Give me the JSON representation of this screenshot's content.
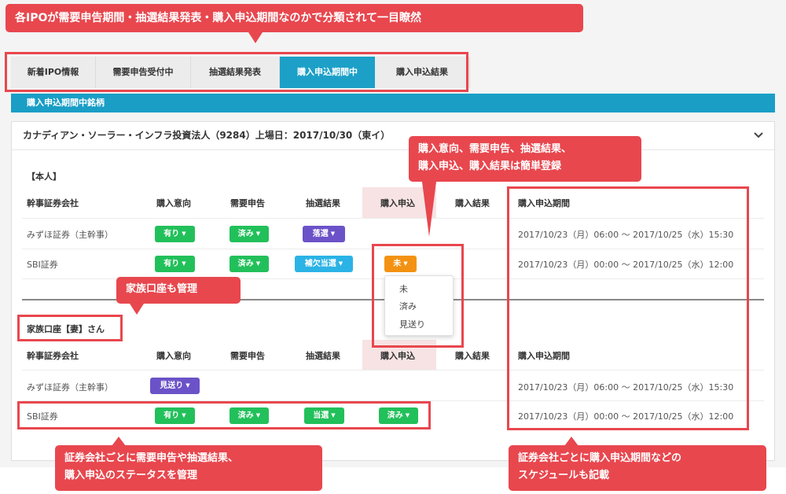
{
  "callouts": {
    "top": "各IPOが需要申告期間・抽選結果発表・購入申込期間なのかで分類されて一目瞭然",
    "register_line1": "購入意向、需要申告、抽選結果、",
    "register_line2": "購入申込、購入結果は簡単登録",
    "family": "家族口座も管理",
    "status_line1": "証券会社ごとに需要申告や抽選結果、",
    "status_line2": "購入申込のステータスを管理",
    "schedule_line1": "証券会社ごとに購入申込期間などの",
    "schedule_line2": "スケジュールも記載"
  },
  "tabs": [
    "新着IPO情報",
    "需要申告受付中",
    "抽選結果発表",
    "購入申込期間中",
    "購入申込結果"
  ],
  "active_tab": "購入申込期間中",
  "section_title": "購入申込期間中銘柄",
  "panel": {
    "title": "カナディアン・ソーラー・インフラ投資法人（9284）上場日：2017/10/30（東イ）",
    "toggle_icon": "chevron-down-icon"
  },
  "headers": {
    "broker": "幹事証券会社",
    "intent": "購入意向",
    "demand": "需要申告",
    "lottery": "抽選結果",
    "apply": "購入申込",
    "result": "購入結果",
    "period": "購入申込期間"
  },
  "self": {
    "label": "【本人】",
    "rows": [
      {
        "broker": "みずほ証券（主幹事）",
        "intent": "有り",
        "demand": "済み",
        "lottery": "落選",
        "apply": "",
        "period": "2017/10/23（月）06:00 〜 2017/10/25（水）15:30"
      },
      {
        "broker": "SBI証券",
        "intent": "有り",
        "demand": "済み",
        "lottery": "補欠当選",
        "apply": "未",
        "period": "2017/10/23（月）00:00 〜 2017/10/25（水）12:00"
      }
    ]
  },
  "dropdown_options": [
    "未",
    "済み",
    "見送り"
  ],
  "family": {
    "label": "家族口座【妻】さん",
    "rows": [
      {
        "broker": "みずほ証券（主幹事）",
        "intent": "見送り",
        "period": "2017/10/23（月）06:00 〜 2017/10/25（水）15:30"
      },
      {
        "broker": "SBI証券",
        "intent": "有り",
        "demand": "済み",
        "lottery": "当選",
        "apply": "済み",
        "period": "2017/10/23（月）00:00 〜 2017/10/25（水）12:00"
      }
    ]
  },
  "colors": {
    "accent": "#1da0c8",
    "callout": "#e8474e",
    "badge_green": "#22c05a",
    "badge_purple": "#6b52c8",
    "badge_blue": "#2bb3e6",
    "badge_orange": "#f39212"
  }
}
